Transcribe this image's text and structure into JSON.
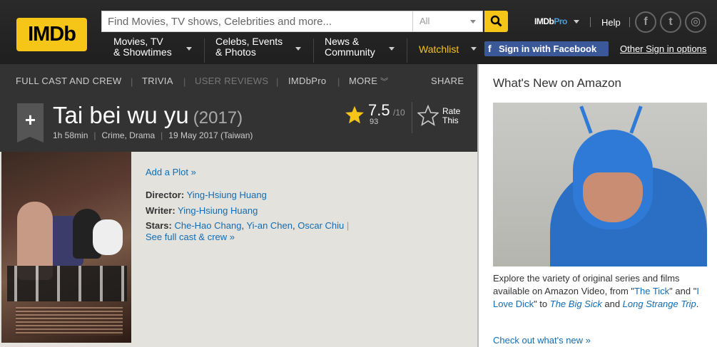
{
  "header": {
    "logo_text": "IMDb",
    "search_placeholder": "Find Movies, TV shows, Celebrities and more...",
    "search_category": "All",
    "imdbpro_prefix": "IMDb",
    "imdbpro_suffix": "Pro",
    "help": "Help",
    "menu": [
      {
        "line1": "Movies, TV",
        "line2": "& Showtimes"
      },
      {
        "line1": "Celebs, Events",
        "line2": "& Photos"
      },
      {
        "line1": "News &",
        "line2": "Community"
      }
    ],
    "watchlist": "Watchlist",
    "fb_signin": "Sign in with Facebook",
    "other_signin": "Other Sign in options",
    "social": {
      "facebook": "f",
      "twitter": "t",
      "instagram": "◎"
    }
  },
  "subnav": {
    "full_cast": "FULL CAST AND CREW",
    "trivia": "TRIVIA",
    "user_reviews": "USER REVIEWS",
    "imdbpro": "IMDbPro",
    "more": "MORE",
    "share": "SHARE"
  },
  "title": {
    "name": "Tai bei wu yu",
    "year": "(2017)",
    "runtime": "1h 58min",
    "genres": "Crime, Drama",
    "release": "19 May 2017 (Taiwan)",
    "rating": "7.5",
    "rating_outof": "/10",
    "rating_count": "93",
    "rate_this_line1": "Rate",
    "rate_this_line2": "This"
  },
  "main": {
    "add_plot": "Add a Plot »",
    "director_label": "Director:",
    "director": "Ying-Hsiung Huang",
    "writer_label": "Writer:",
    "writer": "Ying-Hsiung Huang",
    "stars_label": "Stars:",
    "stars": [
      "Che-Hao Chang",
      "Yi-an Chen",
      "Oscar Chiu"
    ],
    "full_cast": "See full cast & crew »"
  },
  "sidebar": {
    "title": "What's New on Amazon",
    "text_part1": "Explore the variety of original series and films available on Amazon Video, from \"",
    "link1": "The Tick",
    "text_part2": "\" and \"",
    "link2": "I Love Dick",
    "text_part3": "\" to ",
    "link3": "The Big Sick",
    "text_part4": " and ",
    "link4": "Long Strange Trip",
    "text_part5": ".",
    "check_out": "Check out what's new »"
  },
  "colors": {
    "accent": "#f5c518",
    "link": "#136cb2",
    "facebook": "#3b5998",
    "header_bg": "#222222",
    "title_bg": "#333333"
  }
}
